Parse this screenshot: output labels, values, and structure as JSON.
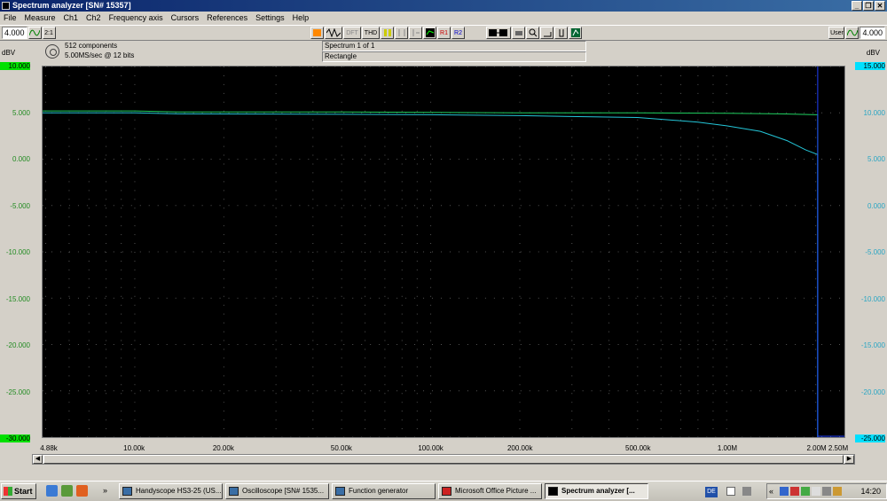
{
  "window": {
    "title": "Spectrum analyzer  [SN# 15357]"
  },
  "menu": [
    "File",
    "Measure",
    "Ch1",
    "Ch2",
    "Frequency axis",
    "Cursors",
    "References",
    "Settings",
    "Help"
  ],
  "toolbar": {
    "left_value": "4.000",
    "left_toggle": "2:1",
    "dft_label": "DFT",
    "thd_label": "THD",
    "r1_label": "R1",
    "r2_label": "R2",
    "user_label": "User",
    "right_value": "4.000"
  },
  "info": {
    "components": "512 components",
    "sample_rate": "5.00MS/sec @ 12 bits",
    "spectrum": "Spectrum 1 of 1",
    "window_func": "Rectangle"
  },
  "axes": {
    "left_unit": "dBV",
    "right_unit": "dBV",
    "left_ticks": [
      "10.000",
      "5.000",
      "0.000",
      "-5.000",
      "-10.000",
      "-15.000",
      "-20.000",
      "-25.000",
      "-30.000"
    ],
    "right_ticks": [
      "15.000",
      "10.000",
      "5.000",
      "0.000",
      "-5.000",
      "-10.000",
      "-15.000",
      "-20.000",
      "-25.000"
    ],
    "x_ticks": [
      "4.88k",
      "10.00k",
      "20.00k",
      "50.00k",
      "100.00k",
      "200.00k",
      "500.00k",
      "1.00M",
      "2.00M",
      "2.50M"
    ]
  },
  "colors": {
    "ch1": "#1fd060",
    "ch2": "#24c6d8",
    "ch1_highlight": "#00e000",
    "ch2_highlight": "#00e0ff",
    "plot_bg": "#000000"
  },
  "chart_data": {
    "type": "line",
    "xscale": "log",
    "xlim": [
      4880,
      2500000
    ],
    "ylim_left": [
      -30,
      10
    ],
    "ylim_right": [
      -25,
      15
    ],
    "ylabel": "dBV",
    "series": [
      {
        "axis": "left",
        "x": [
          4880,
          10000,
          14000,
          20000,
          50000,
          100000,
          200000,
          500000,
          1000000,
          1500000,
          2000000,
          2030000,
          2031000
        ],
        "y": [
          5.2,
          5.2,
          5.1,
          5.1,
          5.1,
          5.05,
          5.0,
          5.0,
          4.95,
          4.9,
          4.8,
          4.8,
          -30
        ]
      },
      {
        "axis": "right",
        "x": [
          4880,
          10000,
          14000,
          50000,
          100000,
          200000,
          500000,
          800000,
          1000000,
          1300000,
          1600000,
          1850000,
          2030000,
          2031000
        ],
        "y": [
          10.0,
          10.0,
          9.9,
          9.85,
          9.8,
          9.7,
          9.5,
          9.0,
          8.6,
          8.0,
          7.0,
          6.0,
          5.5,
          -25
        ]
      }
    ]
  },
  "taskbar": {
    "start": "Start",
    "tasks": [
      "Handyscope HS3-25 (US...",
      "Oscilloscope  [SN# 1535...",
      "Function generator",
      "Microsoft Office Picture ...",
      "Spectrum analyzer  [..."
    ],
    "lang": "DE",
    "clock": "14:20"
  }
}
